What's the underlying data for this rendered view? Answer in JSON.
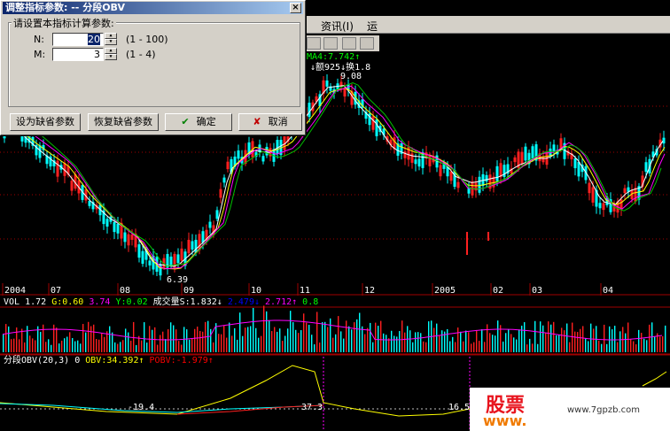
{
  "menu": {
    "item1": "资讯(I)",
    "item2": "运"
  },
  "price_panel": {
    "ma4": "MA4:7.742",
    "ma4_arrow": "↑",
    "annot_top": "↓额925↓换1.8",
    "high_label": "9.08",
    "low_label": "6.39"
  },
  "x_axis": {
    "labels": [
      "2004",
      "07",
      "08",
      "09",
      "10",
      "11",
      "12",
      "2005",
      "02",
      "03",
      "04"
    ]
  },
  "vol_panel": {
    "vol": "VOL 1.72",
    "g": "G:0.60",
    "v3": "3.74",
    "y": "Y:0.02",
    "cjl": "成交量S:1.832",
    "d1": "↓",
    "v4": "2.479↓",
    "v5": "2.712↑",
    "v6": "0.8"
  },
  "obv_panel": {
    "title": "分段OBV(20,3) 0",
    "obv": "OBV:34.392↑",
    "pobv": "POBV:-1.979↑",
    "val1": "-19.4",
    "val2": "37.3",
    "val3": "16.5"
  },
  "dialog": {
    "title": "调整指标参数: -- 分段OBV",
    "close": "×",
    "group_title": "请设置本指标计算参数:",
    "params": [
      {
        "label": "N:",
        "value": "20",
        "range": "(1 - 100)"
      },
      {
        "label": "M:",
        "value": "3",
        "range": "(1 - 4)"
      }
    ],
    "buttons": {
      "default": "设为缺省参数",
      "restore": "恢复缺省参数",
      "ok": "确定",
      "ok_icon": "✔",
      "cancel": "取消",
      "cancel_icon": "✘"
    }
  },
  "watermark": {
    "logo": "股票",
    "logo2": "www.",
    "url": "www.7gpzb.com"
  },
  "colors": {
    "up": "#ff2020",
    "down": "#00ffff",
    "ma1": "#ffffff",
    "ma2": "#ffff00",
    "ma3": "#ff00ff",
    "ma4": "#00c000",
    "grid": "#a00000",
    "title_bar": "#0a246a"
  }
}
